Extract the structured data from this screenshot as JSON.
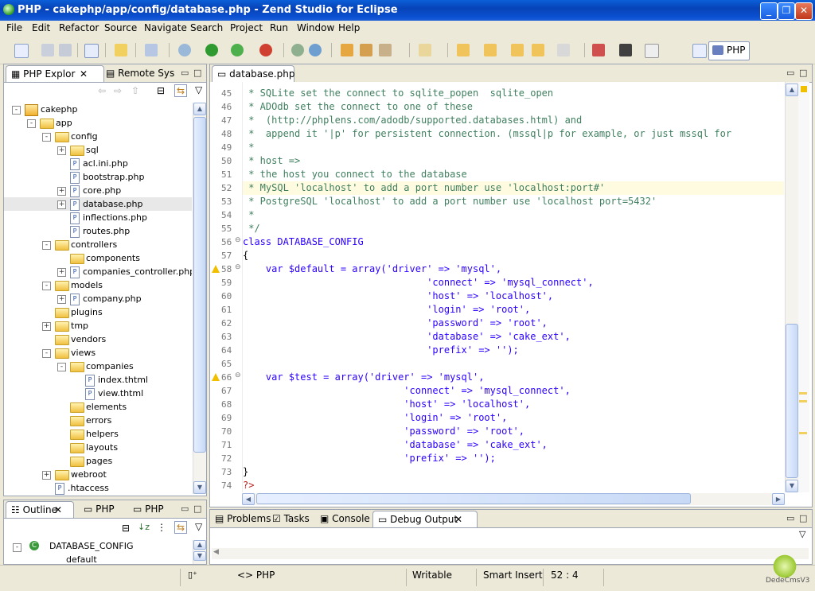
{
  "window": {
    "title": "PHP - cakephp/app/config/database.php - Zend Studio for Eclipse",
    "minimize": "_",
    "maximize": "❐",
    "close": "✕"
  },
  "menu": [
    "File",
    "Edit",
    "Refactor",
    "Source",
    "Navigate",
    "Search",
    "Project",
    "Run",
    "Window",
    "Help"
  ],
  "perspective": {
    "label": "PHP"
  },
  "explorer": {
    "tabs": [
      "PHP Explor",
      "Remote Sys"
    ],
    "tree": [
      {
        "label": "cakephp",
        "depth": 0,
        "type": "project",
        "exp": "-"
      },
      {
        "label": "app",
        "depth": 1,
        "type": "folder",
        "exp": "-"
      },
      {
        "label": "config",
        "depth": 2,
        "type": "folder",
        "exp": "-"
      },
      {
        "label": "sql",
        "depth": 3,
        "type": "folder",
        "exp": "+"
      },
      {
        "label": "acl.ini.php",
        "depth": 3,
        "type": "file",
        "exp": ""
      },
      {
        "label": "bootstrap.php",
        "depth": 3,
        "type": "file",
        "exp": ""
      },
      {
        "label": "core.php",
        "depth": 3,
        "type": "file",
        "exp": "+"
      },
      {
        "label": "database.php",
        "depth": 3,
        "type": "file",
        "exp": "+"
      },
      {
        "label": "inflections.php",
        "depth": 3,
        "type": "file",
        "exp": ""
      },
      {
        "label": "routes.php",
        "depth": 3,
        "type": "file",
        "exp": ""
      },
      {
        "label": "controllers",
        "depth": 2,
        "type": "folder",
        "exp": "-"
      },
      {
        "label": "components",
        "depth": 3,
        "type": "folder",
        "exp": ""
      },
      {
        "label": "companies_controller.php",
        "depth": 3,
        "type": "file",
        "exp": "+"
      },
      {
        "label": "models",
        "depth": 2,
        "type": "folder",
        "exp": "-"
      },
      {
        "label": "company.php",
        "depth": 3,
        "type": "file",
        "exp": "+"
      },
      {
        "label": "plugins",
        "depth": 2,
        "type": "folder",
        "exp": ""
      },
      {
        "label": "tmp",
        "depth": 2,
        "type": "folder",
        "exp": "+"
      },
      {
        "label": "vendors",
        "depth": 2,
        "type": "folder",
        "exp": ""
      },
      {
        "label": "views",
        "depth": 2,
        "type": "folder",
        "exp": "-"
      },
      {
        "label": "companies",
        "depth": 3,
        "type": "folder",
        "exp": "-"
      },
      {
        "label": "index.thtml",
        "depth": 4,
        "type": "file",
        "exp": ""
      },
      {
        "label": "view.thtml",
        "depth": 4,
        "type": "file",
        "exp": ""
      },
      {
        "label": "elements",
        "depth": 3,
        "type": "folder",
        "exp": ""
      },
      {
        "label": "errors",
        "depth": 3,
        "type": "folder",
        "exp": ""
      },
      {
        "label": "helpers",
        "depth": 3,
        "type": "folder",
        "exp": ""
      },
      {
        "label": "layouts",
        "depth": 3,
        "type": "folder",
        "exp": ""
      },
      {
        "label": "pages",
        "depth": 3,
        "type": "folder",
        "exp": ""
      },
      {
        "label": "webroot",
        "depth": 2,
        "type": "folder",
        "exp": "+"
      },
      {
        "label": ".htaccess",
        "depth": 2,
        "type": "file",
        "exp": ""
      }
    ]
  },
  "outline": {
    "tabs": [
      "Outline",
      "PHP",
      "PHP"
    ],
    "items": [
      "DATABASE_CONFIG",
      "default"
    ]
  },
  "editor": {
    "tab": "database.php",
    "lines": [
      {
        "n": "45",
        "t": " * SQLite set the connect to sqlite_popen  sqlite_open",
        "c": "cm"
      },
      {
        "n": "46",
        "t": " * ADOdb set the connect to one of these",
        "c": "cm"
      },
      {
        "n": "47",
        "t": " *  (http://phplens.com/adodb/supported.databases.html) and",
        "c": "cm"
      },
      {
        "n": "48",
        "t": " *  append it '|p' for persistent connection. (mssql|p for example, or just mssql for",
        "c": "cm"
      },
      {
        "n": "49",
        "t": " *",
        "c": "cm"
      },
      {
        "n": "50",
        "t": " * host =>",
        "c": "cm"
      },
      {
        "n": "51",
        "t": " * the host you connect to the database",
        "c": "cm"
      },
      {
        "n": "52",
        "t": " * MySQL 'localhost' to add a port number use 'localhost:port#'",
        "c": "cm"
      },
      {
        "n": "53",
        "t": " * PostgreSQL 'localhost' to add a port number use 'localhost port=5432'",
        "c": "cm"
      },
      {
        "n": "54",
        "t": " *",
        "c": "cm"
      },
      {
        "n": "55",
        "t": " */",
        "c": "cm"
      },
      {
        "n": "56",
        "t": "class DATABASE_CONFIG",
        "c": "mix"
      },
      {
        "n": "57",
        "t": "{",
        "c": ""
      },
      {
        "n": "58",
        "t": "    var $default = array('driver' => 'mysql',",
        "c": "mix"
      },
      {
        "n": "59",
        "t": "                                'connect' => 'mysql_connect',",
        "c": "mix"
      },
      {
        "n": "60",
        "t": "                                'host' => 'localhost',",
        "c": "mix"
      },
      {
        "n": "61",
        "t": "                                'login' => 'root',",
        "c": "mix"
      },
      {
        "n": "62",
        "t": "                                'password' => 'root',",
        "c": "mix"
      },
      {
        "n": "63",
        "t": "                                'database' => 'cake_ext',",
        "c": "mix"
      },
      {
        "n": "64",
        "t": "                                'prefix' => '');",
        "c": "mix"
      },
      {
        "n": "65",
        "t": "",
        "c": ""
      },
      {
        "n": "66",
        "t": "    var $test = array('driver' => 'mysql',",
        "c": "mix"
      },
      {
        "n": "67",
        "t": "                            'connect' => 'mysql_connect',",
        "c": "mix"
      },
      {
        "n": "68",
        "t": "                            'host' => 'localhost',",
        "c": "mix"
      },
      {
        "n": "69",
        "t": "                            'login' => 'root',",
        "c": "mix"
      },
      {
        "n": "70",
        "t": "                            'password' => 'root',",
        "c": "mix"
      },
      {
        "n": "71",
        "t": "                            'database' => 'cake_ext',",
        "c": "mix"
      },
      {
        "n": "72",
        "t": "                            'prefix' => '');",
        "c": "mix"
      },
      {
        "n": "73",
        "t": "}",
        "c": ""
      },
      {
        "n": "74",
        "t": "?>",
        "c": "php"
      }
    ]
  },
  "bottom": {
    "tabs": [
      "Problems",
      "Tasks",
      "Console",
      "Debug Output"
    ]
  },
  "status": {
    "lang": "<> PHP",
    "writable": "Writable",
    "insert": "Smart Insert",
    "pos": "52 : 4"
  },
  "watermark": "DedeCmsV3"
}
